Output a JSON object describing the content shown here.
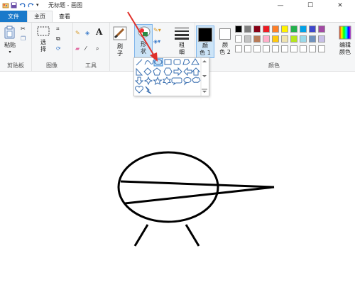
{
  "window": {
    "title": "无标题 - 画图",
    "minimize": "—",
    "maximize": "☐",
    "close": "✕"
  },
  "tabs": [
    {
      "label": "文件"
    },
    {
      "label": "主页"
    },
    {
      "label": "查看"
    }
  ],
  "clipboard": {
    "paste_label": "粘贴",
    "group_label": "剪贴板"
  },
  "image": {
    "select_label_1": "选",
    "select_label_2": "择",
    "group_label": "图像"
  },
  "tools": {
    "group_label": "工具"
  },
  "brushes": {
    "label_1": "刷",
    "label_2": "子"
  },
  "shapes": {
    "label_1": "形",
    "label_2": "状"
  },
  "size": {
    "label_1": "粗",
    "label_2": "细"
  },
  "color1": {
    "label_1": "颜",
    "label_2": "色 1",
    "value": "#000000"
  },
  "color2": {
    "label_1": "颜",
    "label_2": "色 2",
    "value": "#ffffff"
  },
  "colors": {
    "group_label": "颜色",
    "edit_label_1": "编辑",
    "edit_label_2": "颜色",
    "row1": [
      "#000000",
      "#7f7f7f",
      "#880015",
      "#ed1c24",
      "#ff7f27",
      "#fff200",
      "#22b14c",
      "#00a2e8",
      "#3f48cc",
      "#a349a4"
    ],
    "row2": [
      "#ffffff",
      "#c3c3c3",
      "#b97a57",
      "#ffaec9",
      "#ffc90e",
      "#efe4b0",
      "#b5e61d",
      "#99d9ea",
      "#7092be",
      "#c8bfe7"
    ]
  }
}
